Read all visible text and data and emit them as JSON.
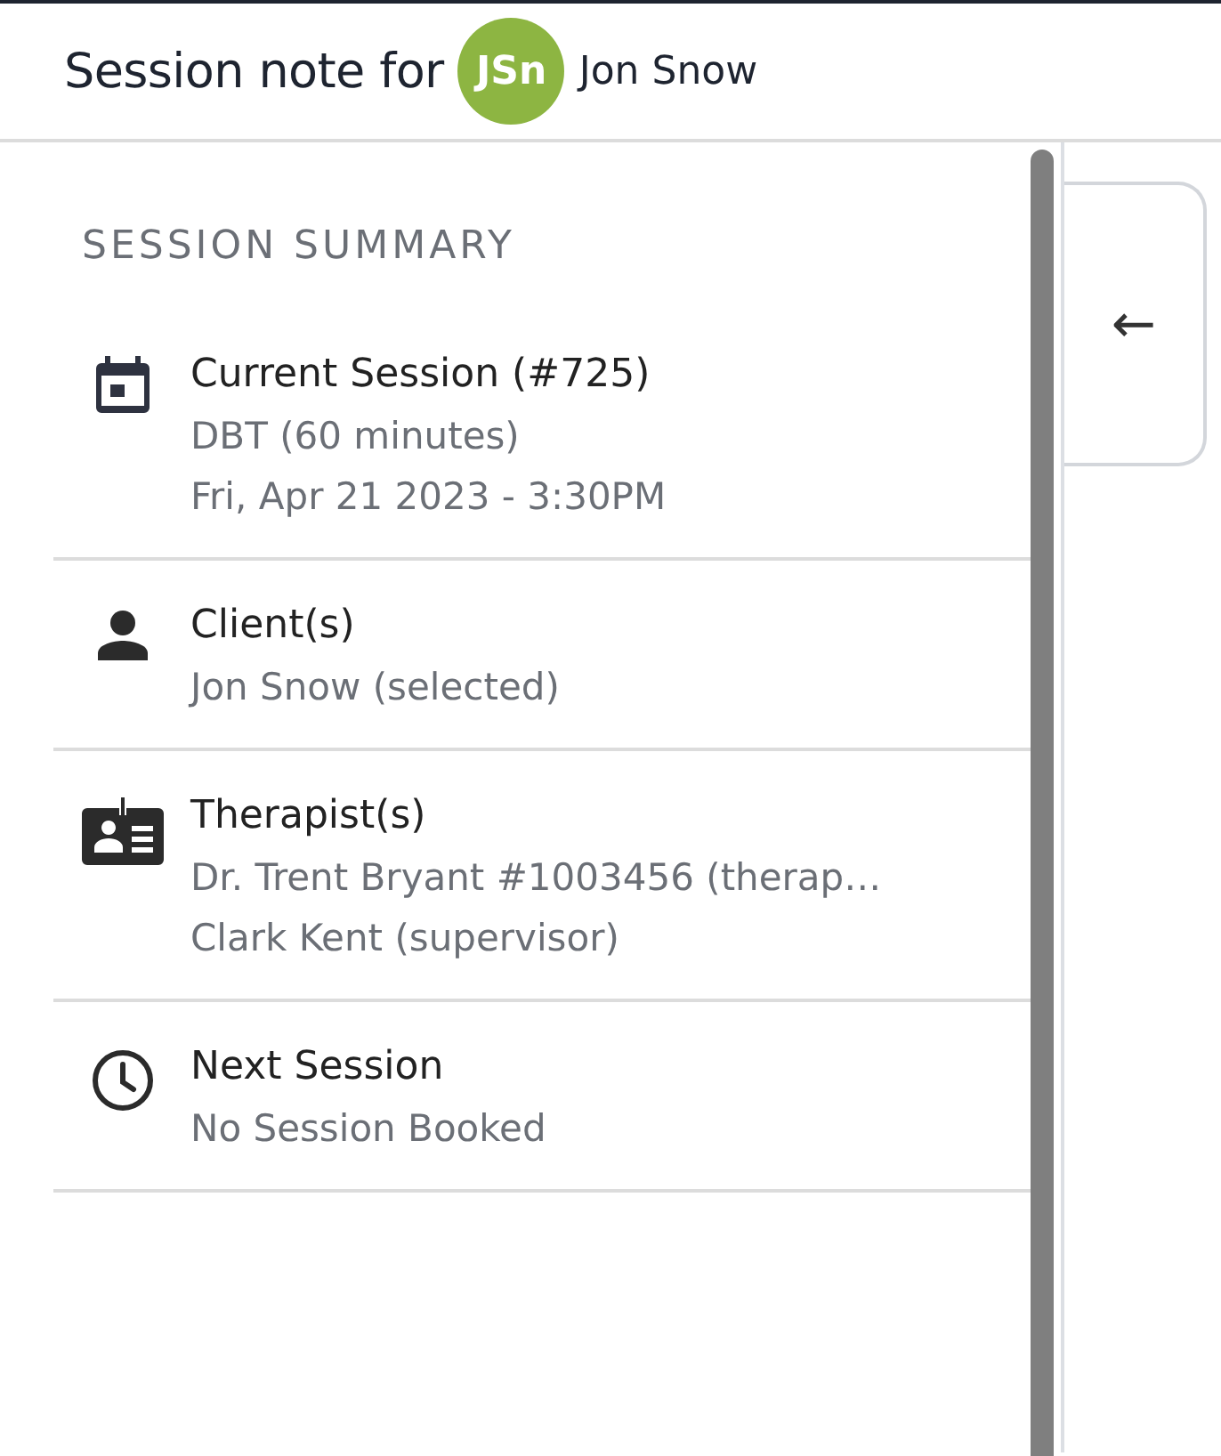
{
  "header": {
    "title": "Session note for",
    "avatar": {
      "initials": "JSn",
      "color": "#8db542"
    },
    "client_name": "Jon Snow"
  },
  "summary": {
    "heading": "SESSION SUMMARY",
    "items": [
      {
        "kind": "session",
        "title": "Current Session (#725)",
        "lines": [
          "DBT (60 minutes)",
          "Fri, Apr 21 2023 - 3:30PM"
        ]
      },
      {
        "kind": "client",
        "title": "Client(s)",
        "lines": [
          "Jon Snow (selected)"
        ]
      },
      {
        "kind": "therapist",
        "title": "Therapist(s)",
        "lines": [
          "Dr. Trent Bryant #1003456 (therap…",
          "Clark Kent (supervisor)"
        ]
      },
      {
        "kind": "next",
        "title": "Next Session",
        "lines": [
          "No Session Booked"
        ]
      }
    ]
  },
  "collapse_button": {
    "icon": "←"
  }
}
